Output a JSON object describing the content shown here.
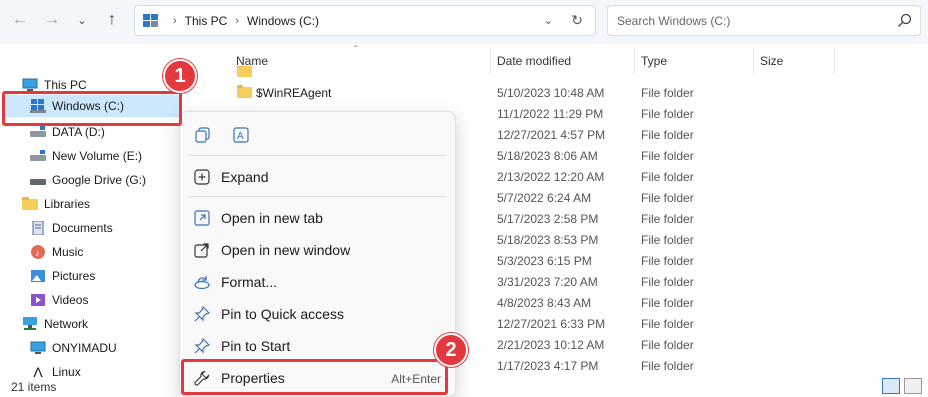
{
  "address_bar": {
    "crumbs": [
      "This PC",
      "Windows (C:)"
    ]
  },
  "search": {
    "placeholder": "Search Windows (C:)"
  },
  "sidebar": {
    "items": [
      {
        "label": "This PC",
        "icon": "monitor-icon"
      },
      {
        "label": "Windows (C:)",
        "icon": "windows-drive-icon"
      },
      {
        "label": "DATA (D:)",
        "icon": "drive-icon"
      },
      {
        "label": "New Volume (E:)",
        "icon": "drive-icon"
      },
      {
        "label": "Google Drive (G:)",
        "icon": "drive-icon"
      },
      {
        "label": "Libraries",
        "icon": "libraries-icon"
      },
      {
        "label": "Documents",
        "icon": "documents-icon"
      },
      {
        "label": "Music",
        "icon": "music-icon"
      },
      {
        "label": "Pictures",
        "icon": "pictures-icon"
      },
      {
        "label": "Videos",
        "icon": "videos-icon"
      },
      {
        "label": "Network",
        "icon": "network-icon"
      },
      {
        "label": "ONYIMADU",
        "icon": "computer-icon"
      },
      {
        "label": "Linux",
        "icon": "linux-icon"
      }
    ]
  },
  "status_bar": {
    "items": "21 items"
  },
  "file_list": {
    "columns": [
      "Name",
      "Date modified",
      "Type",
      "Size"
    ],
    "rows": [
      {
        "name": "$WinREAgent",
        "date": "5/10/2023 10:48 AM",
        "type": "File folder"
      },
      {
        "name": "",
        "date": "11/1/2022 11:29 PM",
        "type": "File folder"
      },
      {
        "name": "",
        "date": "12/27/2021 4:57 PM",
        "type": "File folder"
      },
      {
        "name": "",
        "date": "5/18/2023 8:06 AM",
        "type": "File folder"
      },
      {
        "name": "",
        "date": "2/13/2022 12:20 AM",
        "type": "File folder"
      },
      {
        "name": "",
        "date": "5/7/2022 6:24 AM",
        "type": "File folder"
      },
      {
        "name": "",
        "date": "5/17/2023 2:58 PM",
        "type": "File folder"
      },
      {
        "name": "",
        "date": "5/18/2023 8:53 PM",
        "type": "File folder"
      },
      {
        "name": "",
        "date": "5/3/2023 6:15 PM",
        "type": "File folder"
      },
      {
        "name": "",
        "date": "3/31/2023 7:20 AM",
        "type": "File folder"
      },
      {
        "name": "",
        "date": "4/8/2023 8:43 AM",
        "type": "File folder"
      },
      {
        "name": "",
        "date": "12/27/2021 6:33 PM",
        "type": "File folder"
      },
      {
        "name": "",
        "date": "2/21/2023 10:12 AM",
        "type": "File folder"
      },
      {
        "name": "",
        "date": "1/17/2023 4:17 PM",
        "type": "File folder"
      }
    ]
  },
  "context_menu": {
    "items": [
      {
        "label": "Expand",
        "icon": "expand-icon"
      },
      {
        "label": "Open in new tab",
        "icon": "new-tab-icon"
      },
      {
        "label": "Open in new window",
        "icon": "new-window-icon"
      },
      {
        "label": "Format...",
        "icon": "format-icon"
      },
      {
        "label": "Pin to Quick access",
        "icon": "pin-icon"
      },
      {
        "label": "Pin to Start",
        "icon": "pin-icon"
      },
      {
        "label": "Properties",
        "icon": "wrench-icon",
        "shortcut": "Alt+Enter"
      }
    ]
  },
  "annotations": {
    "badge_1": "1",
    "badge_2": "2"
  },
  "colors": {
    "highlight": "#e4383f",
    "selection": "#cce8ff",
    "accent": "#0067c0"
  }
}
